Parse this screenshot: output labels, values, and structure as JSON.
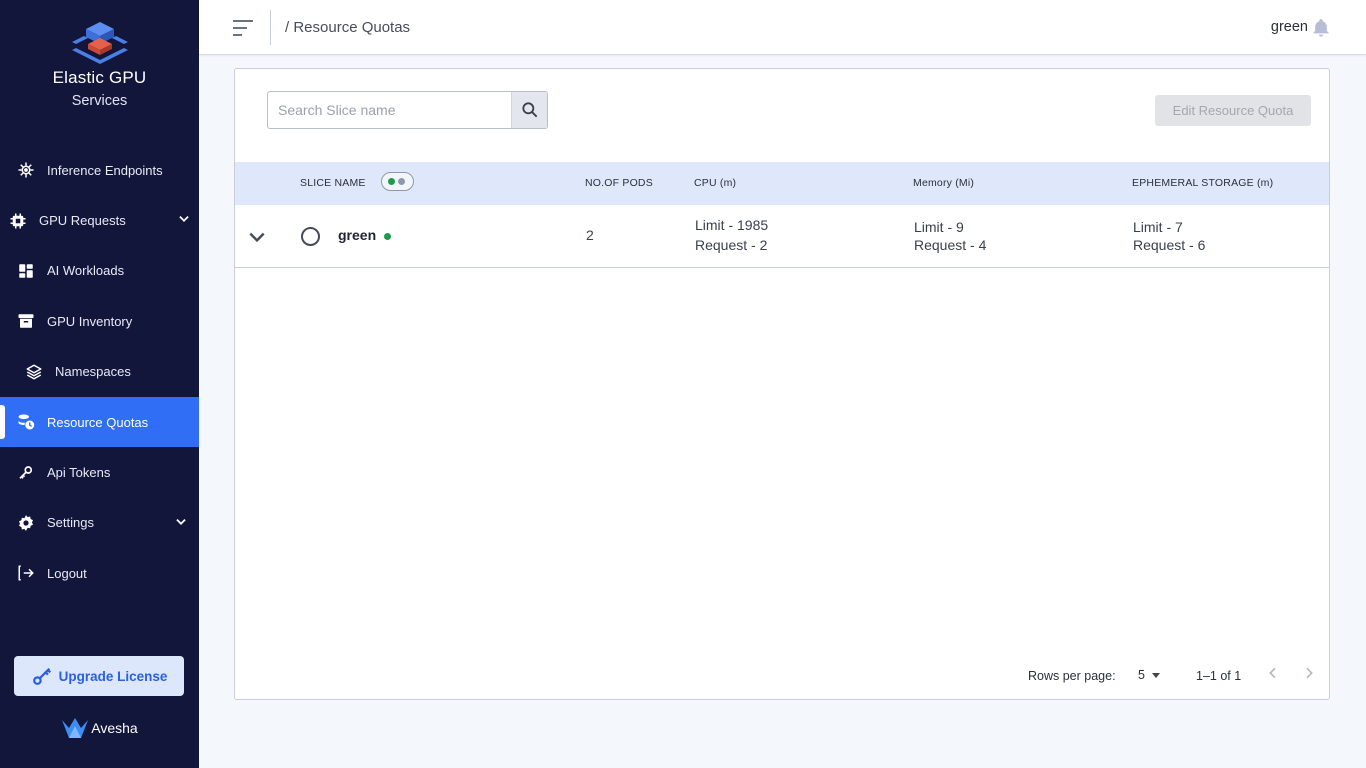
{
  "brand": {
    "title": "Elastic GPU",
    "subtitle": "Services",
    "footer": "Avesha"
  },
  "sidebar": {
    "items": [
      {
        "label": "Inference Endpoints",
        "icon": "chip-gear-icon"
      },
      {
        "label": "GPU Requests",
        "icon": "chip-icon",
        "expandable": true
      },
      {
        "label": "AI Workloads",
        "icon": "dashboard-icon"
      },
      {
        "label": "GPU Inventory",
        "icon": "archive-icon"
      },
      {
        "label": "Namespaces",
        "icon": "layers-icon"
      },
      {
        "label": "Resource Quotas",
        "icon": "quota-icon",
        "active": true
      },
      {
        "label": "Api Tokens",
        "icon": "key-icon"
      },
      {
        "label": "Settings",
        "icon": "gear-icon",
        "expandable": true
      },
      {
        "label": "Logout",
        "icon": "logout-icon"
      }
    ],
    "upgrade_label": "Upgrade License"
  },
  "header": {
    "breadcrumb": "/ Resource Quotas",
    "user": "green"
  },
  "toolbar": {
    "search_placeholder": "Search Slice name",
    "edit_label": "Edit Resource Quota"
  },
  "table": {
    "headers": {
      "slice_name": "SLICE NAME",
      "pods": "NO.OF PODS",
      "cpu": "CPU (m)",
      "memory": "Memory (Mi)",
      "storage": "EPHEMERAL STORAGE (m)"
    },
    "rows": [
      {
        "name": "green",
        "status_color": "#1e9a4a",
        "pods": "2",
        "cpu_limit": "Limit - 1985",
        "cpu_request": "Request - 2",
        "mem_limit": "Limit - 9",
        "mem_request": "Request - 4",
        "storage_limit": "Limit - 7",
        "storage_request": "Request - 6"
      }
    ]
  },
  "pagination": {
    "rows_label": "Rows per page:",
    "rows_value": "5",
    "range": "1–1 of 1"
  },
  "colors": {
    "sidebar_bg": "#12163b",
    "accent": "#2f6ef5",
    "table_header_bg": "#dfe8fb",
    "status_green": "#1e9a4a"
  }
}
